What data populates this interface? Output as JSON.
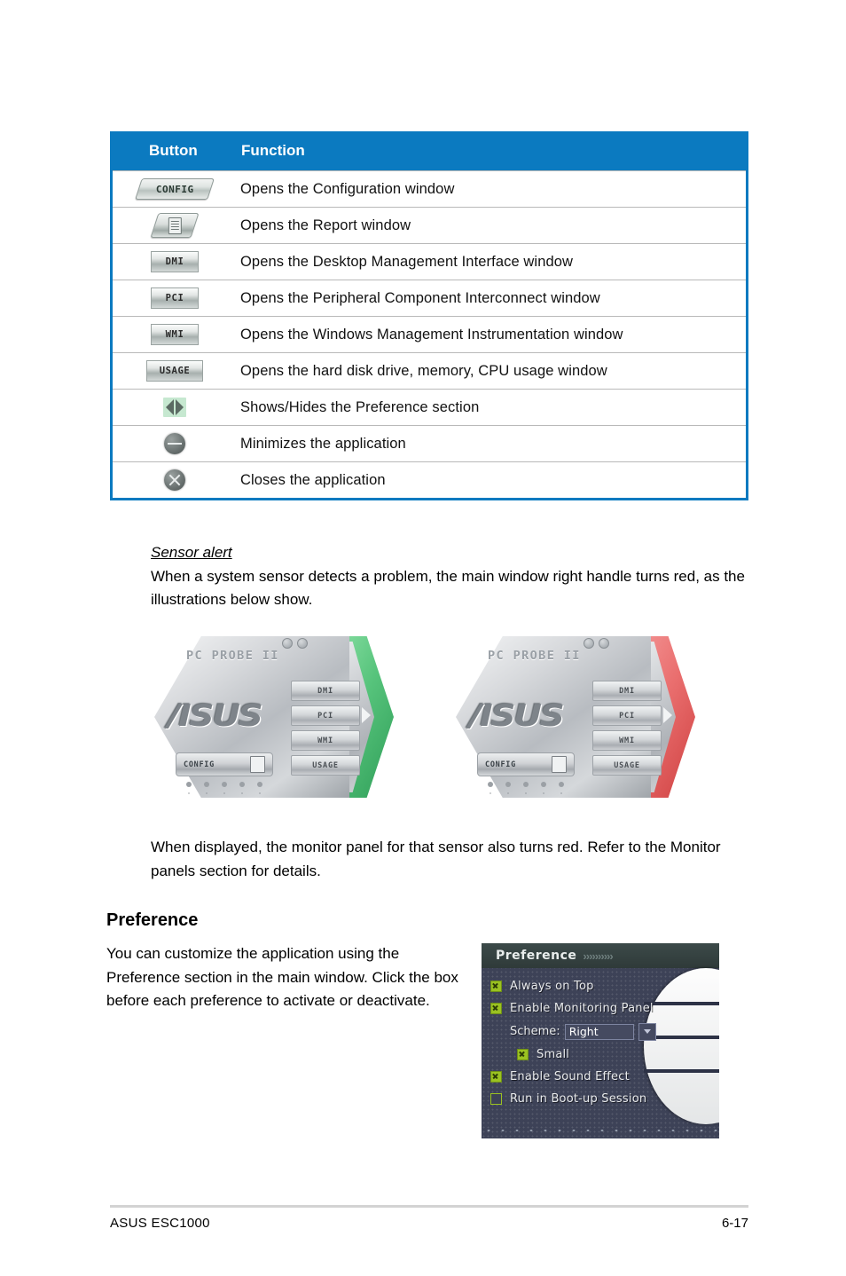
{
  "table": {
    "headers": {
      "button": "Button",
      "function": "Function"
    },
    "rows": [
      {
        "icon": "config-button-icon",
        "icon_label": "CONFIG",
        "function": "Opens the Configuration window"
      },
      {
        "icon": "report-button-icon",
        "icon_label": "",
        "function": "Opens the Report window"
      },
      {
        "icon": "dmi-button-icon",
        "icon_label": "DMI",
        "function": "Opens the Desktop Management Interface window"
      },
      {
        "icon": "pci-button-icon",
        "icon_label": "PCI",
        "function": "Opens the Peripheral Component Interconnect window"
      },
      {
        "icon": "wmi-button-icon",
        "icon_label": "WMI",
        "function": "Opens the Windows Management Instrumentation window"
      },
      {
        "icon": "usage-button-icon",
        "icon_label": "USAGE",
        "function": "Opens the hard disk drive, memory, CPU usage window"
      },
      {
        "icon": "show-hide-arrows-icon",
        "icon_label": "",
        "function": "Shows/Hides the Preference section"
      },
      {
        "icon": "minimize-icon",
        "icon_label": "",
        "function": "Minimizes the application"
      },
      {
        "icon": "close-icon",
        "icon_label": "",
        "function": "Closes the application"
      }
    ]
  },
  "sensor_alert": {
    "heading": "Sensor alert",
    "body": "When a system sensor detects a problem, the main window right handle turns red, as the illustrations below show."
  },
  "illustrations": {
    "normal": {
      "title": "PC PROBE II",
      "handle_state": "green",
      "tabs": [
        "DMI",
        "PCI",
        "WMI",
        "USAGE"
      ],
      "config_label": "CONFIG",
      "brand": "/ISUS"
    },
    "alert": {
      "title": "PC PROBE II",
      "handle_state": "red",
      "tabs": [
        "DMI",
        "PCI",
        "WMI",
        "USAGE"
      ],
      "config_label": "CONFIG",
      "brand": "/ISUS"
    }
  },
  "monitor_note": "When displayed, the monitor panel for that sensor also turns red. Refer to the Monitor panels section for details.",
  "preference_section": {
    "heading": "Preference",
    "body": "You can customize the application using the Preference section in the main window. Click the box before each preference to activate or deactivate."
  },
  "preference_panel": {
    "title": "Preference",
    "title_chevrons": "››››››››››",
    "items": [
      {
        "label": "Always on Top",
        "checked": true,
        "indent": 0
      },
      {
        "label": "Enable Monitoring Panel",
        "checked": true,
        "indent": 0
      },
      {
        "label": "Small",
        "checked": true,
        "indent": 2
      },
      {
        "label": "Enable Sound Effect",
        "checked": true,
        "indent": 0
      },
      {
        "label": "Run in Boot-up Session",
        "checked": false,
        "indent": 0
      }
    ],
    "scheme": {
      "label": "Scheme:",
      "value": "Right"
    }
  },
  "footer": {
    "left": "ASUS ESC1000",
    "right": "6-17"
  },
  "colors": {
    "header_blue": "#0b7ac0",
    "checkbox_green": "#9bc221",
    "alert_red": "#cf4141",
    "ok_green": "#2f9e58"
  }
}
